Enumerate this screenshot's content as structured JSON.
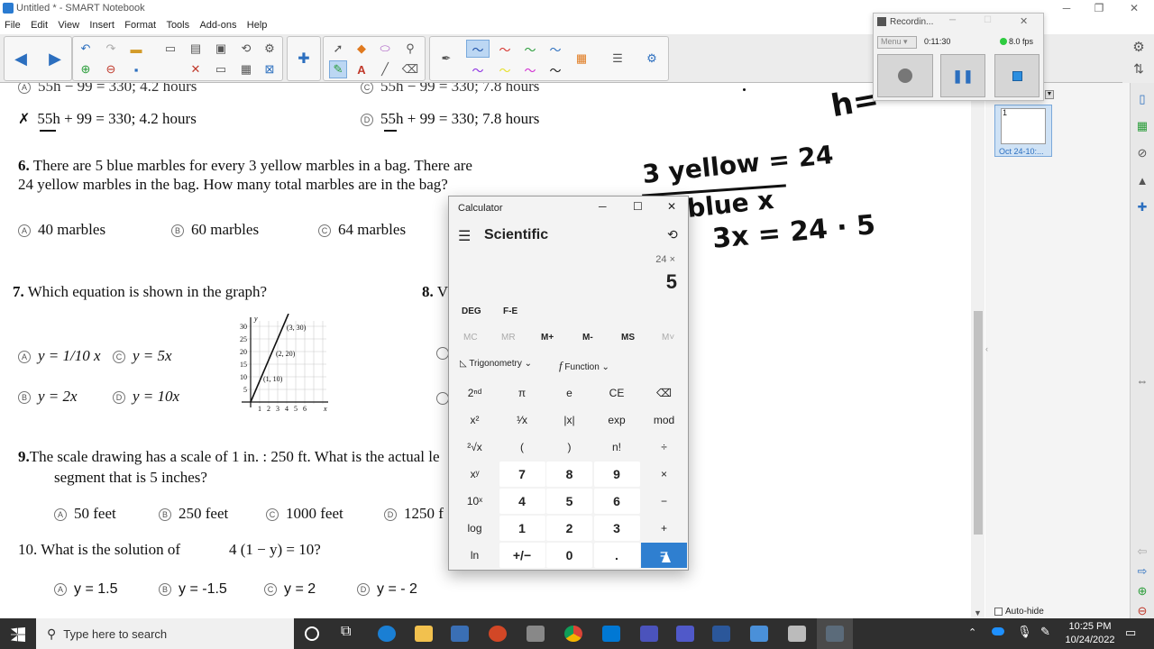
{
  "window": {
    "title": "Untitled * - SMART Notebook"
  },
  "menu": [
    "File",
    "Edit",
    "View",
    "Insert",
    "Format",
    "Tools",
    "Add-ons",
    "Help"
  ],
  "recorder": {
    "title": "Recordin...",
    "menu": "Menu",
    "time": "0:11:30",
    "fps": "8.0 fps"
  },
  "page_thumb": {
    "number": "1",
    "label": "Oct 24-10:..."
  },
  "doc": {
    "q5_top_a": "55h − 99 = 330; 4.2 hours",
    "q5_top_c": "55h − 99 = 330; 7.8 hours",
    "q5_b": "55h + 99 = 330; 4.2 hours",
    "q5_d_letter": "D",
    "q5_d": "55h + 99 = 330; 7.8 hours",
    "q6_num": "6.",
    "q6_line1": "There are 5 blue marbles for every 3 yellow marbles in a bag. There are",
    "q6_line2": "24 yellow marbles in the bag. How many total marbles are in the bag?",
    "q6_a_letter": "A",
    "q6_a": "40 marbles",
    "q6_b_letter": "B",
    "q6_b": "60 marbles",
    "q6_c_letter": "C",
    "q6_c": "64 marbles",
    "q7_num": "7.",
    "q7_text": "Which equation is shown in the graph?",
    "q7_a_letter": "A",
    "q7_a": "y = 1/10 x",
    "q7_c_letter": "C",
    "q7_c": "y = 5x",
    "q7_b_letter": "B",
    "q7_b": "y = 2x",
    "q7_d_letter": "D",
    "q7_d": "y = 10x",
    "q8_num": "8.",
    "q8_partial": "V",
    "q9_num": "9.",
    "q9_line1": "The scale drawing has a scale of 1 in. : 250 ft. What is the actual le",
    "q9_line2": "segment that is 5 inches?",
    "q9_a_letter": "A",
    "q9_a": "50 feet",
    "q9_b_letter": "B",
    "q9_b": "250 feet",
    "q9_c_letter": "C",
    "q9_c": "1000 feet",
    "q9_d_letter": "D",
    "q9_d": "1250 f",
    "q10_num": "10.",
    "q10_text": "What is the solution of",
    "q10_eq": "4 (1 − y) = 10?",
    "q10_a_letter": "A",
    "q10_a": "y = 1.5",
    "q10_b_letter": "B",
    "q10_b": "y = -1.5",
    "q10_c_letter": "C",
    "q10_c": "y = 2",
    "q10_d_letter": "D",
    "q10_d": "y = - 2"
  },
  "graph": {
    "y_label": "y",
    "x_label": "x",
    "y_ticks": [
      "30",
      "25",
      "20",
      "15",
      "10",
      "5"
    ],
    "x_ticks": [
      "1",
      "2",
      "3",
      "4",
      "5",
      "6"
    ],
    "points": [
      "(3, 30)",
      "(2, 20)",
      "(1, 10)"
    ]
  },
  "ink": {
    "line1": "3 yellow = 24",
    "line2": "blue x",
    "line3": "3x = 24 · 5",
    "h": "h="
  },
  "calculator": {
    "title": "Calculator",
    "mode": "Scientific",
    "expression": "24 ×",
    "display": "5",
    "deg": "DEG",
    "fe": "F-E",
    "memory": [
      "MC",
      "MR",
      "M+",
      "M-",
      "MS",
      "M˅"
    ],
    "trig": "Trigonometry",
    "func": "Function",
    "rows": [
      [
        "2ⁿᵈ",
        "π",
        "e",
        "CE",
        "⌫"
      ],
      [
        "x²",
        "¹⁄x",
        "|x|",
        "exp",
        "mod"
      ],
      [
        "²√x",
        "(",
        ")",
        "n!",
        "÷"
      ],
      [
        "xʸ",
        "7",
        "8",
        "9",
        "×"
      ],
      [
        "10ˣ",
        "4",
        "5",
        "6",
        "−"
      ],
      [
        "log",
        "1",
        "2",
        "3",
        "+"
      ],
      [
        "ln",
        "+/−",
        "0",
        ".",
        "="
      ]
    ]
  },
  "autohide": "Auto-hide",
  "taskbar": {
    "search": "Type here to search",
    "time": "10:25 PM",
    "date": "10/24/2022"
  }
}
